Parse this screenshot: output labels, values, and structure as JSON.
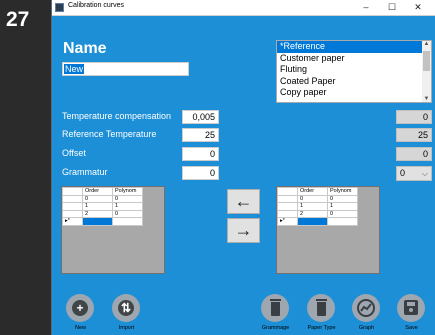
{
  "step_number": "27",
  "window": {
    "title": "Calibration curves",
    "minimize": "–",
    "maximize": "☐",
    "close": "✕"
  },
  "name_section": {
    "label": "Name",
    "value": "New"
  },
  "reference_list": {
    "items": [
      "*Reference",
      "Customer paper",
      "Fluting",
      "Coated Paper",
      "Copy paper"
    ],
    "selected_index": 0
  },
  "parameters": [
    {
      "label": "Temperature compensation",
      "value": "0,005",
      "ref_value": "0"
    },
    {
      "label": "Reference Temperature",
      "value": "25",
      "ref_value": "25"
    },
    {
      "label": "Offset",
      "value": "0",
      "ref_value": "0"
    },
    {
      "label": "Grammatur",
      "value": "0",
      "ref_value": "0"
    }
  ],
  "left_grid": {
    "columns": [
      "Order",
      "Polynom"
    ],
    "rows": [
      [
        "0",
        "0"
      ],
      [
        "1",
        "1"
      ],
      [
        "2",
        "0"
      ]
    ],
    "new_row_marker": "▸*"
  },
  "right_grid": {
    "columns": [
      "Order",
      "Polynom"
    ],
    "rows": [
      [
        "0",
        "0"
      ],
      [
        "1",
        "1"
      ],
      [
        "2",
        "0"
      ]
    ],
    "new_row_marker": "▸*"
  },
  "arrows": {
    "back": "←",
    "forward": "→"
  },
  "toolbar": {
    "new_label": "New",
    "new_glyph": "+",
    "import_label": "Import",
    "import_glyph": "⇅",
    "delete_grammage_label": "Grammage",
    "delete_paper_type_label": "Paper Type",
    "graph_label": "Graph",
    "save_label": "Save"
  },
  "colors": {
    "window_bg": "#1c8fd6",
    "selection": "#0078d7",
    "toolbar_icon": "#9ea6b0"
  }
}
